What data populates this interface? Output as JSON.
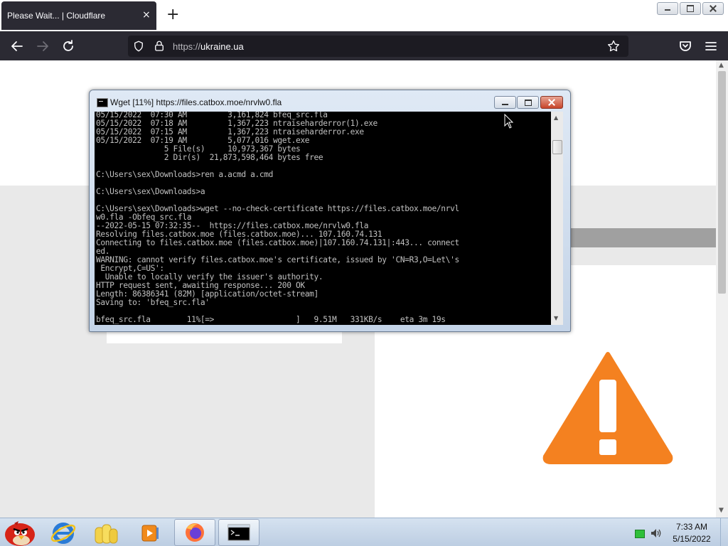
{
  "browser": {
    "tab_title": "Please Wait... | Cloudflare",
    "tab_close": "×",
    "new_tab": "+",
    "url_scheme": "https://",
    "url_host": "ukraine.ua"
  },
  "console": {
    "title": "Wget [11%] https://files.catbox.moe/nrvlw0.fla",
    "lines": [
      "05/15/2022  07:30 AM         3,161,824 bfeq_src.fla",
      "05/15/2022  07:18 AM         1,367,223 ntraiseharderror(1).exe",
      "05/15/2022  07:15 AM         1,367,223 ntraiseharderror.exe",
      "05/15/2022  07:19 AM         5,077,016 wget.exe",
      "               5 File(s)     10,973,367 bytes",
      "               2 Dir(s)  21,873,598,464 bytes free",
      "",
      "C:\\Users\\sex\\Downloads>ren a.acmd a.cmd",
      "",
      "C:\\Users\\sex\\Downloads>a",
      "",
      "C:\\Users\\sex\\Downloads>wget --no-check-certificate https://files.catbox.moe/nrvl",
      "w0.fla -Obfeq_src.fla",
      "--2022-05-15 07:32:35--  https://files.catbox.moe/nrvlw0.fla",
      "Resolving files.catbox.moe (files.catbox.moe)... 107.160.74.131",
      "Connecting to files.catbox.moe (files.catbox.moe)|107.160.74.131|:443... connect",
      "ed.",
      "WARNING: cannot verify files.catbox.moe's certificate, issued by 'CN=R3,O=Let\\'s",
      " Encrypt,C=US':",
      "  Unable to locally verify the issuer's authority.",
      "HTTP request sent, awaiting response... 200 OK",
      "Length: 86386341 (82M) [application/octet-stream]",
      "Saving to: 'bfeq_src.fla'",
      "",
      "bfeq_src.fla        11%[=>                  ]   9.51M   331KB/s    eta 3m 19s"
    ]
  },
  "taskbar": {
    "time": "7:33 AM",
    "date": "5/15/2022",
    "items": [
      {
        "name": "angry-birds-icon"
      },
      {
        "name": "internet-explorer-icon"
      },
      {
        "name": "file-explorer-icon"
      },
      {
        "name": "media-player-icon"
      },
      {
        "name": "firefox-icon"
      },
      {
        "name": "command-prompt-icon"
      }
    ]
  },
  "colors": {
    "tab_bg": "#2b2a33",
    "urlbar_bg": "#1c1b22",
    "warning_orange": "#f48120",
    "console_bg": "#000000",
    "console_text": "#c0c0c0"
  }
}
